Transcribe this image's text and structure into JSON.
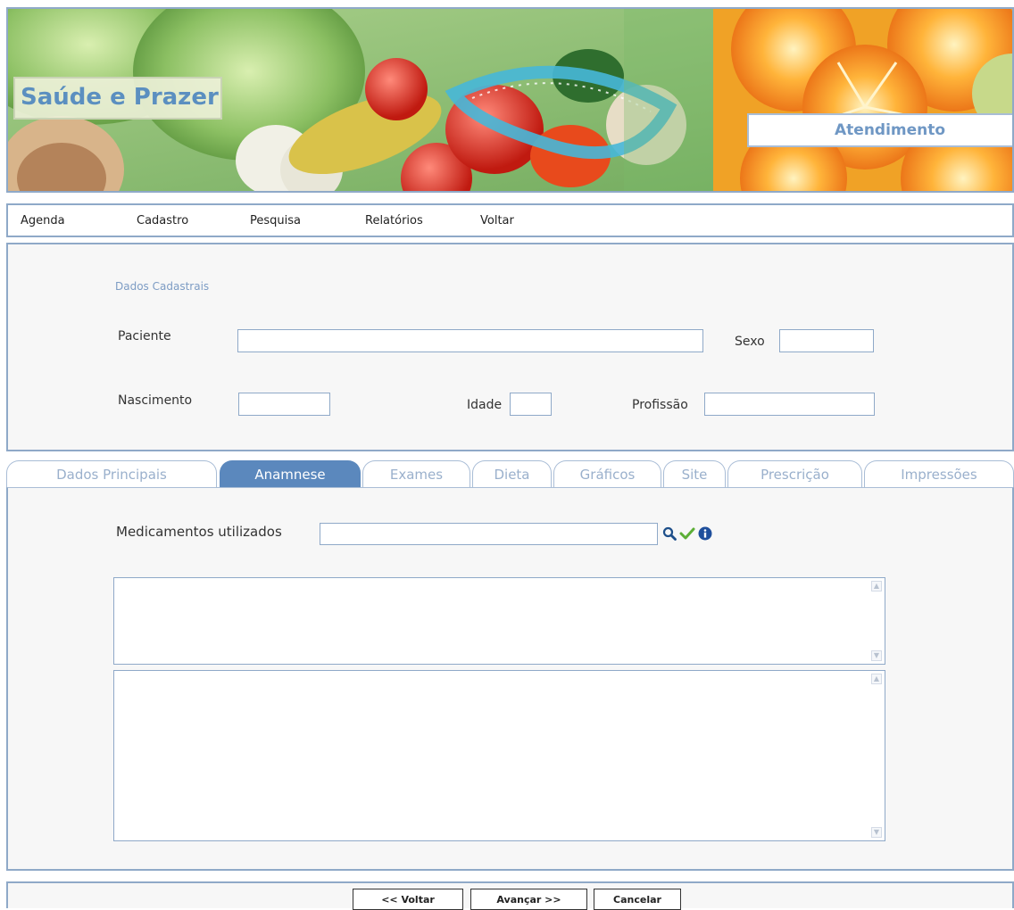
{
  "banner": {
    "brand": "Saúde e Prazer",
    "section": "Atendimento"
  },
  "menu": {
    "items": [
      {
        "label": "Agenda"
      },
      {
        "label": "Cadastro"
      },
      {
        "label": "Pesquisa"
      },
      {
        "label": "Relatórios"
      },
      {
        "label": "Voltar"
      }
    ]
  },
  "registration": {
    "section_title": "Dados Cadastrais",
    "patient_label": "Paciente",
    "patient_value": "",
    "sex_label": "Sexo",
    "sex_value": "",
    "birth_label": "Nascimento",
    "birth_value": "",
    "age_label": "Idade",
    "age_value": "",
    "profession_label": "Profissão",
    "profession_value": ""
  },
  "tabs": {
    "items": [
      {
        "label": "Dados Principais"
      },
      {
        "label": "Anamnese"
      },
      {
        "label": "Exames"
      },
      {
        "label": "Dieta"
      },
      {
        "label": "Gráficos"
      },
      {
        "label": "Site"
      },
      {
        "label": "Prescrição"
      },
      {
        "label": "Impressões"
      }
    ],
    "active": "Anamnese"
  },
  "anamnese": {
    "medications_label": "Medicamentos utilizados",
    "medications_value": "",
    "notes_1": "",
    "notes_2": "",
    "icons": [
      "search-icon",
      "check-icon",
      "info-icon"
    ]
  },
  "footer": {
    "back_label": "<< Voltar",
    "next_label": "Avançar >>",
    "cancel_label": "Cancelar"
  },
  "colors": {
    "border": "#8fa9c8",
    "active_tab": "#5b88bd",
    "inactive_tab_text": "#9ab0cc",
    "brand_text": "#5b8fc0"
  }
}
